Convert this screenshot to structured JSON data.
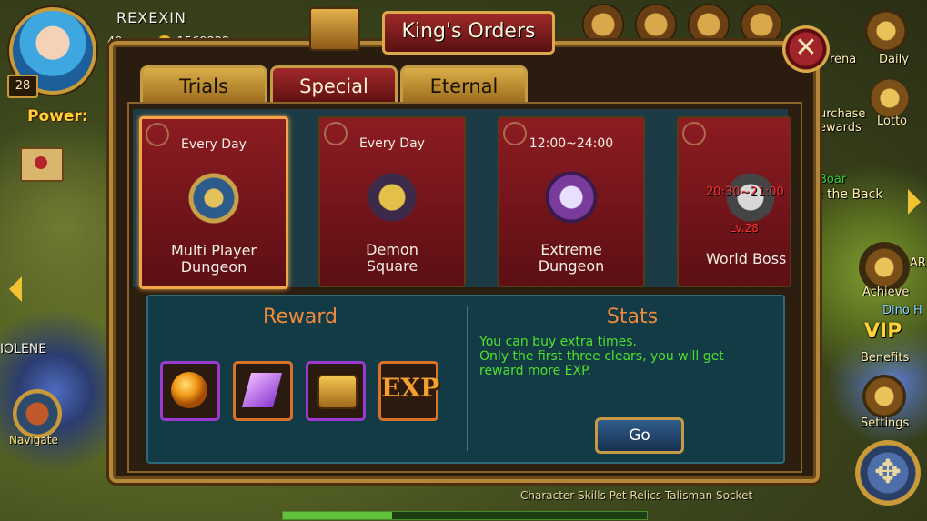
{
  "player": {
    "name": "REXEXIN",
    "level": "28",
    "gold": "1569222",
    "power_label": "Power:",
    "partial_stat": "40"
  },
  "world": {
    "npc_name": "IOLENE",
    "navigate_label": "Navigate",
    "bottom_menu": "Character  Skills  Pet  Relics  Talisman  Socket",
    "side_labels": {
      "arena": "rena",
      "daily": "Daily",
      "purchase_rewards": "urchase\newards",
      "lotto": "Lotto",
      "achieve": "Achieve",
      "vip": "VIP",
      "benefits": "Benefits",
      "settings": "Settings",
      "scroll_text": "e the Back",
      "boss_label": "Boar",
      "dino": "Dino H",
      "ar": "AR"
    }
  },
  "dialog": {
    "title": "King's Orders",
    "tabs": [
      {
        "label": "Trials",
        "active": false
      },
      {
        "label": "Special",
        "active": true
      },
      {
        "label": "Eternal",
        "active": false
      }
    ],
    "cards": [
      {
        "time": "Every Day",
        "name_line1": "Multi Player",
        "name_line2": "Dungeon",
        "icon": "shield-crest-icon",
        "selected": true
      },
      {
        "time": "Every Day",
        "name_line1": "Demon",
        "name_line2": "Square",
        "icon": "demon-skull-icon"
      },
      {
        "time": "12:00~24:00",
        "name_line1": "Extreme",
        "name_line2": "Dungeon",
        "icon": "purple-skull-icon"
      },
      {
        "name_line1": "World Boss",
        "boss_time": "20:30~21:00",
        "boss_level": "Lv.28",
        "icon": "boss-head-icon"
      }
    ],
    "reward_title": "Reward",
    "stats_title": "Stats",
    "stats_lines": [
      "You can buy extra times.",
      "Only the first three clears, you will get",
      "reward more EXP."
    ],
    "reward_items": [
      "orange-orb-icon",
      "purple-crystal-icon",
      "treasure-chest-icon",
      "exp-icon"
    ],
    "exp_text": "EXP",
    "go_label": "Go",
    "close_symbol": "✕"
  },
  "colors": {
    "stats_text": "#4ee12c",
    "section_title": "#f08a3a",
    "card_bg": "#8c1c22",
    "selected_border": "#f3a548"
  }
}
